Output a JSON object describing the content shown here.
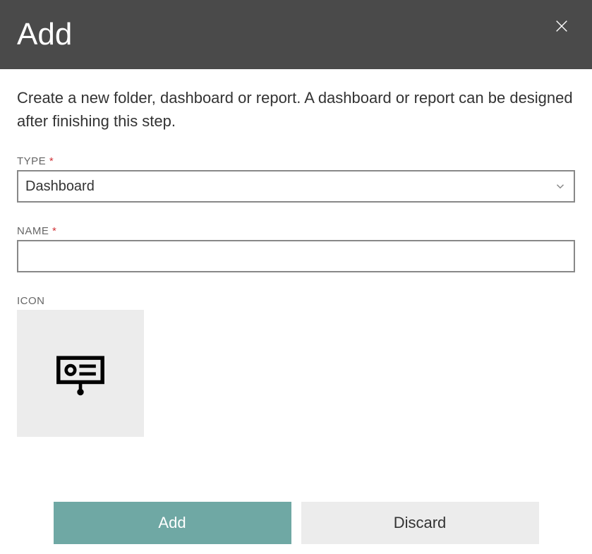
{
  "header": {
    "title": "Add"
  },
  "description": "Create a new folder, dashboard or report. A dashboard or report can be designed after finishing this step.",
  "fields": {
    "type": {
      "label": "TYPE",
      "required": "*",
      "value": "Dashboard"
    },
    "name": {
      "label": "NAME",
      "required": "*",
      "value": ""
    },
    "icon": {
      "label": "ICON",
      "selected": "presentation-icon"
    }
  },
  "buttons": {
    "primary": "Add",
    "secondary": "Discard"
  }
}
